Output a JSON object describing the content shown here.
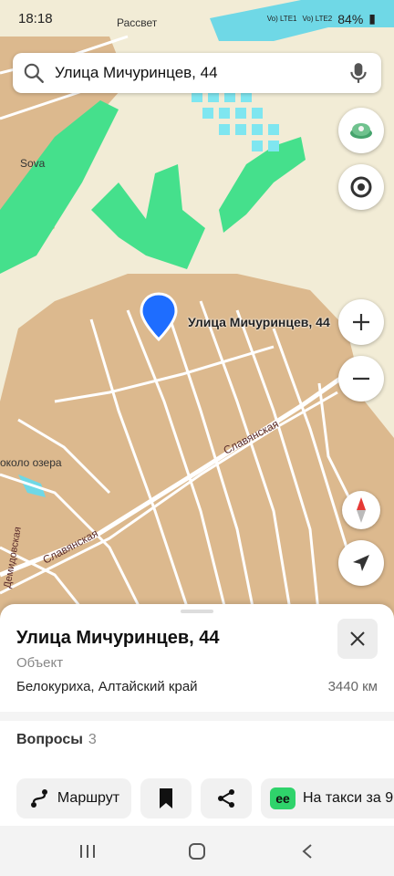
{
  "status": {
    "time": "18:18",
    "battery": "84%",
    "network1": "Vo) LTE1",
    "network2": "Vo) LTE2"
  },
  "search": {
    "query": "Улица Мичуринцев, 44"
  },
  "map": {
    "labels": {
      "top": "Рассвет",
      "poi1": "Sova",
      "poi2": "около озера",
      "street1": "Славянская",
      "street2": "Славянская",
      "street3": "Демидовская"
    },
    "pin_label": "Улица Мичуринцев, 44"
  },
  "card": {
    "title": "Улица Мичуринцев, 44",
    "subtype": "Объект",
    "address": "Белокуриха, Алтайский край",
    "distance": "3440 км",
    "questions_label": "Вопросы",
    "questions_count": "3"
  },
  "actions": {
    "route": "Маршрут",
    "taxi": "На такси за 9"
  },
  "colors": {
    "accent": "#1e6dff",
    "taxi": "#2fd36b",
    "land": "#dcb98e",
    "green": "#45e08c"
  }
}
